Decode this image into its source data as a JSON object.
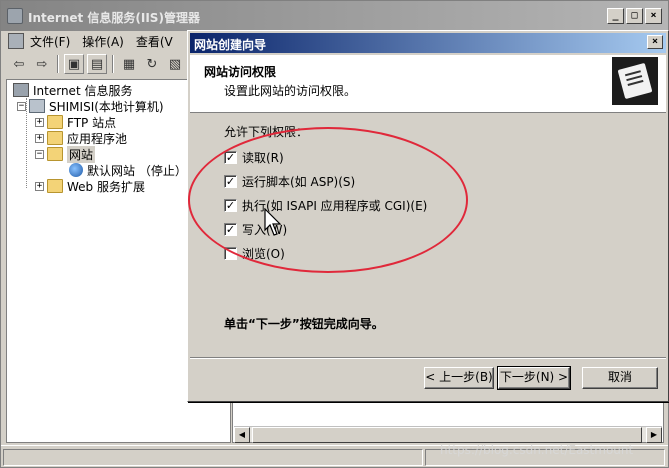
{
  "iis": {
    "title": "Internet 信息服务(IIS)管理器",
    "window_buttons": [
      "_",
      "□",
      "×"
    ],
    "menu": [
      {
        "label": "文件(F)"
      },
      {
        "label": "操作(A)"
      },
      {
        "label": "查看(V"
      }
    ],
    "toolbar": [
      "back-arrow-icon",
      "forward-arrow-icon",
      "up-folder-icon",
      "show-tree-icon",
      "properties-icon",
      "refresh-icon",
      "export-icon"
    ],
    "tree": {
      "root": "Internet 信息服务",
      "computer": "SHIMISI(本地计算机)",
      "ftp": "FTP 站点",
      "app_pools": "应用程序池",
      "websites": "网站",
      "default_site": "默认网站 （停止）",
      "web_ext": "Web 服务扩展"
    }
  },
  "wizard": {
    "title": "网站创建向导",
    "close": "×",
    "heading": "网站访问权限",
    "subheading": "设置此网站的访问权限。",
    "group_label": "允许下列权限：",
    "permissions": [
      {
        "label": "读取(R)",
        "checked": true
      },
      {
        "label": "运行脚本(如 ASP)(S)",
        "checked": true
      },
      {
        "label": "执行(如 ISAPI 应用程序或 CGI)(E)",
        "checked": true
      },
      {
        "label": "写入(W)",
        "checked": true
      },
      {
        "label": "浏览(O)",
        "checked": false
      }
    ],
    "finish_note": "单击“下一步”按钮完成向导。",
    "buttons": {
      "back": "< 上一步(B)",
      "next": "下一步(N) >",
      "cancel": "取消"
    }
  },
  "annotation_color": "#e0283a",
  "watermark": "https://blog.csdn.net/Eastmount"
}
